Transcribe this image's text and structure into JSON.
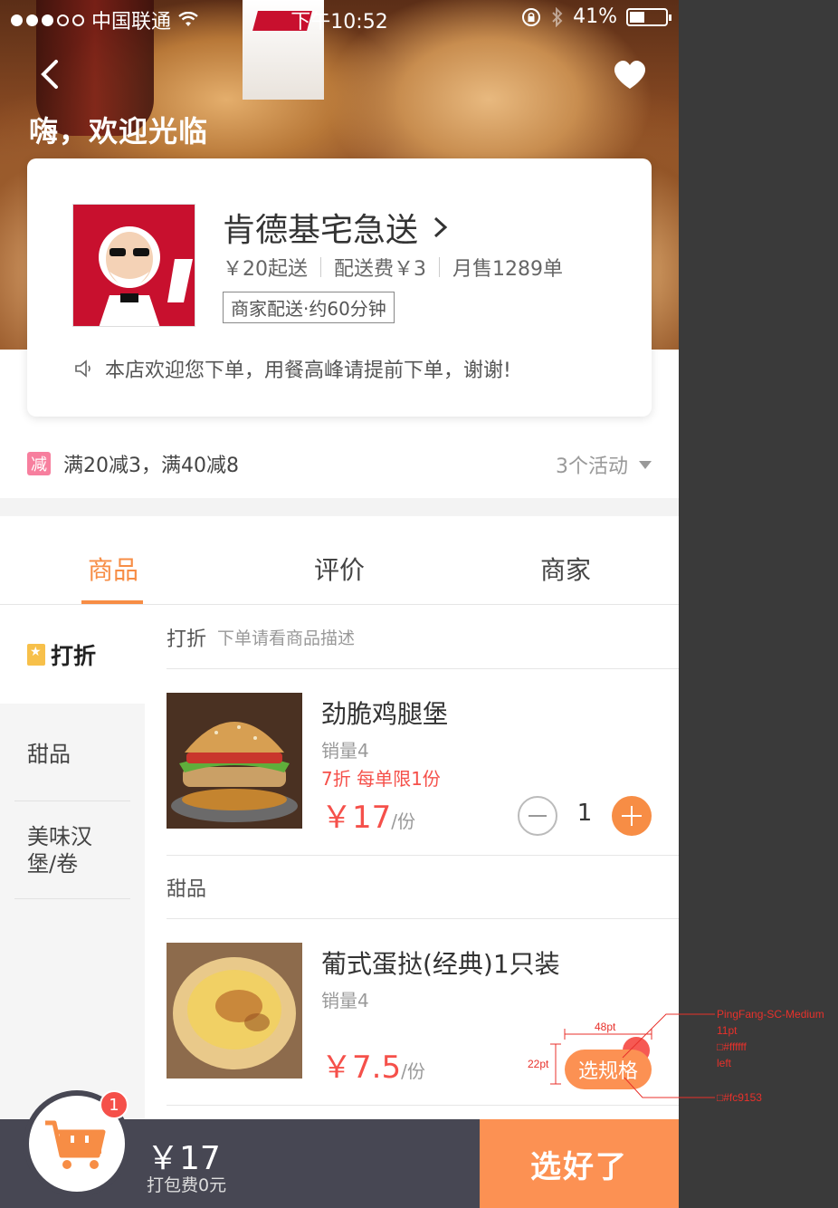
{
  "status_bar": {
    "carrier": "中国联通",
    "time": "下午10:52",
    "battery": "41%"
  },
  "header": {
    "welcome": "嗨，欢迎光临"
  },
  "shop": {
    "name": "肯德基宅急送",
    "min_order": "￥20起送",
    "delivery_fee": "配送费￥3",
    "monthly_sales": "月售1289单",
    "delivery_tag": "商家配送·约60分钟",
    "notice": "本店欢迎您下单，用餐高峰请提前下单，谢谢!"
  },
  "promo": {
    "badge": "减",
    "text": "满20减3，满40减8",
    "more": "3个活动"
  },
  "tabs": [
    {
      "label": "商品"
    },
    {
      "label": "评价"
    },
    {
      "label": "商家"
    }
  ],
  "categories": [
    {
      "label": "打折"
    },
    {
      "label": "甜品"
    },
    {
      "label": "美味汉堡/卷"
    }
  ],
  "sections": [
    {
      "title": "打折",
      "subtitle": "下单请看商品描述"
    },
    {
      "title": "甜品",
      "subtitle": ""
    }
  ],
  "products": [
    {
      "name": "劲脆鸡腿堡",
      "sales": "销量4",
      "discount": "7折 每单限1份",
      "price": "￥17",
      "unit": "/份",
      "qty": "1"
    },
    {
      "name": "葡式蛋挞(经典)1只装",
      "sales": "销量4",
      "price": "￥7.5",
      "unit": "/份",
      "spec_label": "选规格"
    }
  ],
  "cart": {
    "badge": "1",
    "total": "￥17",
    "packing_fee": "打包费0元",
    "checkout_label": "选好了"
  },
  "annotations": {
    "width": "48pt",
    "height": "22pt",
    "font": "PingFang-SC-Medium",
    "size": "11pt",
    "text_color": "#ffffff",
    "align": "left",
    "bg_color": "#fc9153"
  },
  "colors": {
    "accent": "#f78d45",
    "button": "#fc9153",
    "price": "#f5504a",
    "bar": "#474753"
  }
}
